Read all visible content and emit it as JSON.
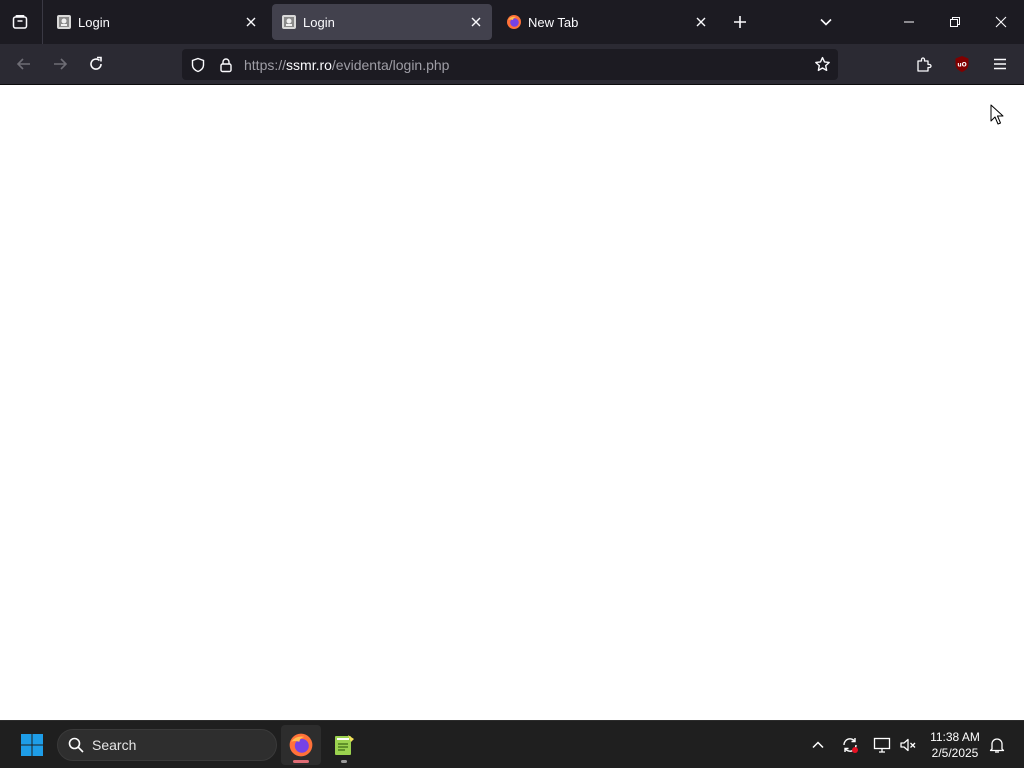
{
  "browser": {
    "tabs": [
      {
        "title": "Login",
        "active": false,
        "favicon": "page-icon"
      },
      {
        "title": "Login",
        "active": true,
        "favicon": "page-icon"
      },
      {
        "title": "New Tab",
        "active": false,
        "favicon": "firefox-icon"
      }
    ],
    "url": {
      "prefix": "https://",
      "domain": "ssmr.ro",
      "path": "/evidenta/login.php"
    },
    "extension": {
      "name": "uBlock Origin",
      "label": "uO"
    }
  },
  "taskbar": {
    "search_label": "Search",
    "clock": {
      "time": "11:38 AM",
      "date": "2/5/2025"
    },
    "apps": [
      {
        "name": "Firefox",
        "running": true
      },
      {
        "name": "Notepad++",
        "running": true
      }
    ]
  },
  "colors": {
    "tabbar_bg": "#1c1b22",
    "active_tab_bg": "#42414d",
    "navbar_bg": "#2b2a33",
    "taskbar_bg": "#1f1f1f",
    "windows_blue": "#1e9de8",
    "running_indicator": "#e06c75"
  }
}
